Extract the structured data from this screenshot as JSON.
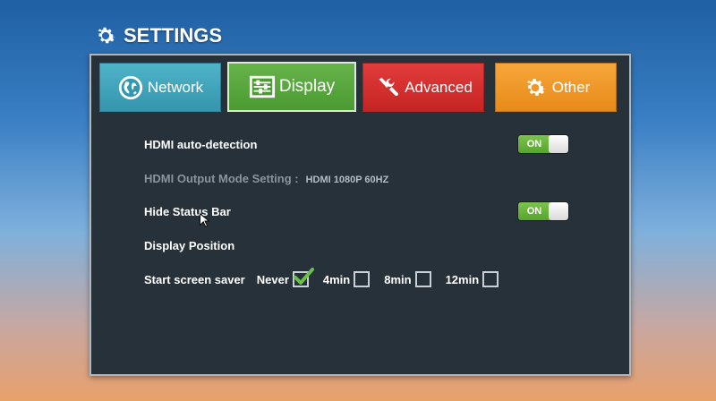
{
  "title": "SETTINGS",
  "tabs": [
    {
      "label": "Network",
      "icon": "globe-icon"
    },
    {
      "label": "Display",
      "icon": "sliders-icon"
    },
    {
      "label": "Advanced",
      "icon": "tools-icon"
    },
    {
      "label": "Other",
      "icon": "gear-icon"
    }
  ],
  "active_tab": "Display",
  "display": {
    "hdmi_auto_detection": {
      "label": "HDMI auto-detection",
      "state": "ON"
    },
    "hdmi_output_mode": {
      "label": "HDMI Output Mode Setting :",
      "value": "HDMI 1080P 60HZ"
    },
    "hide_status_bar": {
      "label": "Hide Status Bar",
      "state": "ON"
    },
    "display_position": {
      "label": "Display Position"
    },
    "screen_saver": {
      "label": "Start screen saver",
      "options": [
        {
          "label": "Never",
          "checked": true
        },
        {
          "label": "4min",
          "checked": false
        },
        {
          "label": "8min",
          "checked": false
        },
        {
          "label": "12min",
          "checked": false
        }
      ]
    }
  },
  "colors": {
    "network": "#3596ad",
    "display": "#4b9a32",
    "advanced": "#c62424",
    "other": "#e88a1a",
    "toggle_on": "#6cb83f",
    "panel": "#26313a"
  }
}
